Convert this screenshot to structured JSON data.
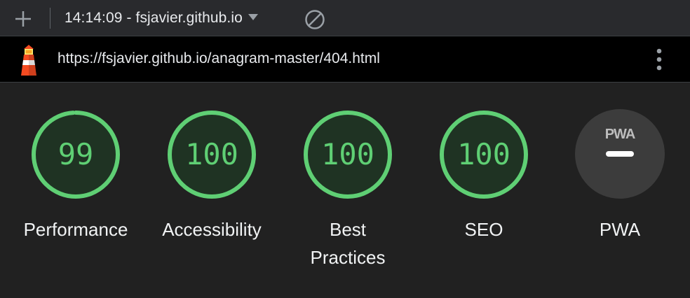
{
  "toolbar": {
    "new_report_icon": "plus-icon",
    "report_selector_label": "14:14:09 - fsjavier.github.io",
    "clear_icon": "block-icon"
  },
  "urlbar": {
    "logo_icon": "lighthouse-icon",
    "url": "https://fsjavier.github.io/anagram-master/404.html",
    "menu_icon": "kebab-menu-icon"
  },
  "colors": {
    "pass_green": "#5fcf74",
    "gauge_fill": "#1f3323",
    "pwa_gray": "#3c3c3c"
  },
  "scores": [
    {
      "label": "Performance",
      "value": "99",
      "fraction": 0.99
    },
    {
      "label": "Accessibility",
      "value": "100",
      "fraction": 1.0
    },
    {
      "label": "Best Practices",
      "value": "100",
      "fraction": 1.0
    },
    {
      "label": "SEO",
      "value": "100",
      "fraction": 1.0
    }
  ],
  "pwa": {
    "badge_text": "PWA",
    "label": "PWA",
    "icon": "pwa-badge-icon"
  }
}
